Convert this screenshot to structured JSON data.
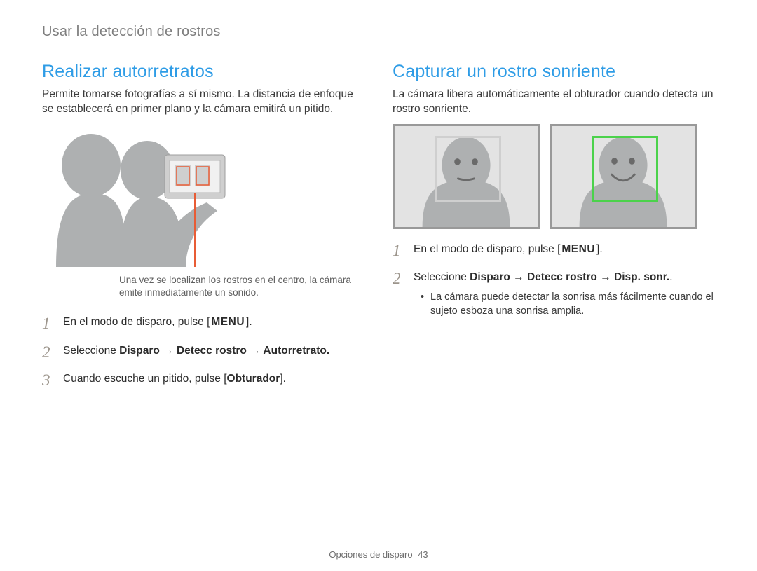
{
  "breadcrumb": "Usar la detección de rostros",
  "left": {
    "title": "Realizar autorretratos",
    "intro": "Permite tomarse fotografías a sí mismo. La distancia de enfoque se establecerá en primer plano y la cámara emitirá un pitido.",
    "callout": "Una vez se localizan los rostros en el centro, la cámara emite inmediatamente un sonido.",
    "steps": {
      "s1_a": "En el modo de disparo, pulse [",
      "s1_menu": "MENU",
      "s1_b": "].",
      "s2_a": "Seleccione ",
      "s2_b": "Disparo → Detecc rostro → Autorretrato.",
      "s3_a": "Cuando escuche un pitido, pulse [",
      "s3_b": "Obturador",
      "s3_c": "]."
    }
  },
  "right": {
    "title": "Capturar un rostro sonriente",
    "intro": "La cámara libera automáticamente el obturador cuando detecta un rostro sonriente.",
    "steps": {
      "s1_a": "En el modo de disparo, pulse [",
      "s1_menu": "MENU",
      "s1_b": "].",
      "s2_a": "Seleccione ",
      "s2_b": "Disparo → Detecc rostro → Disp. sonr.",
      "s2_c": ".",
      "bullet": "La cámara puede detectar la sonrisa más fácilmente cuando el sujeto esboza una sonrisa amplia."
    }
  },
  "footer": {
    "section": "Opciones de disparo",
    "page": "43"
  }
}
